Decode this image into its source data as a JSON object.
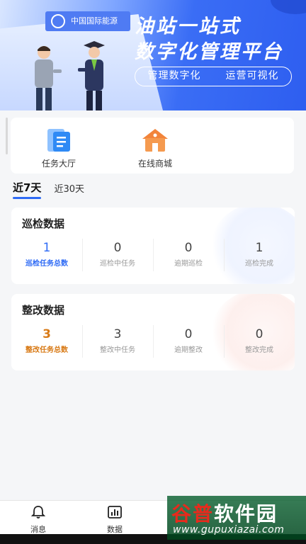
{
  "banner": {
    "sign_text": "中国国际能源",
    "title_line1": "油站一站式",
    "title_line2": "数字化管理平台",
    "pill_left": "管理数字化",
    "pill_right": "运营可视化"
  },
  "quick_entries": [
    {
      "label": "任务大厅",
      "icon": "task-hall-icon"
    },
    {
      "label": "在线商城",
      "icon": "shop-icon"
    }
  ],
  "period_tabs": [
    {
      "label": "近7天",
      "active": true
    },
    {
      "label": "近30天",
      "active": false
    }
  ],
  "inspection": {
    "title": "巡检数据",
    "stats": [
      {
        "value": "1",
        "label": "巡检任务总数"
      },
      {
        "value": "0",
        "label": "巡检中任务"
      },
      {
        "value": "0",
        "label": "逾期巡检"
      },
      {
        "value": "1",
        "label": "巡检完成"
      }
    ]
  },
  "rectification": {
    "title": "整改数据",
    "stats": [
      {
        "value": "3",
        "label": "整改任务总数"
      },
      {
        "value": "3",
        "label": "整改中任务"
      },
      {
        "value": "0",
        "label": "逾期整改"
      },
      {
        "value": "0",
        "label": "整改完成"
      }
    ]
  },
  "bottom_nav": [
    {
      "label": "消息",
      "icon": "bell-icon"
    },
    {
      "label": "数据",
      "icon": "chart-icon"
    }
  ],
  "watermark": {
    "brand_a": "谷普",
    "brand_b": "软件园",
    "url": "www.gupuxiazai.com"
  },
  "colors": {
    "accent_blue": "#2f6bf5",
    "accent_orange": "#d87a16"
  }
}
